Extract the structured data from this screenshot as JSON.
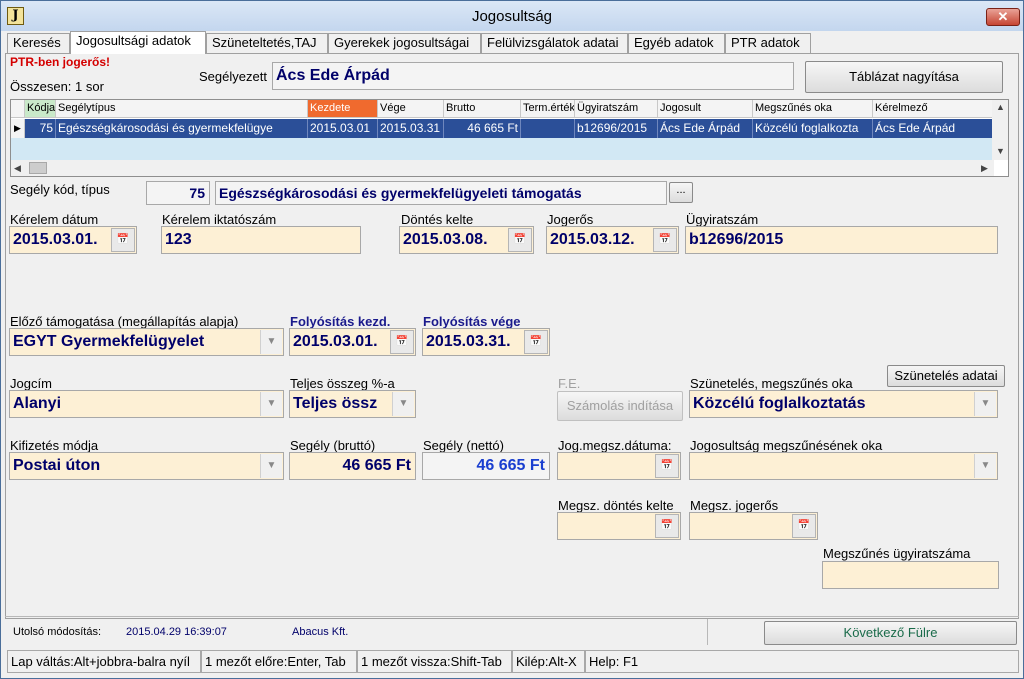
{
  "window": {
    "title": "Jogosultság",
    "app_icon_letter": "J",
    "close_glyph": "✕"
  },
  "tabs": [
    {
      "label": "Keresés"
    },
    {
      "label": "Jogosultsági adatok",
      "active": true
    },
    {
      "label": "Szüneteltetés,TAJ"
    },
    {
      "label": "Gyerekek jogosultságai"
    },
    {
      "label": "Felülvizsgálatok adatai"
    },
    {
      "label": "Egyéb adatok"
    },
    {
      "label": "PTR adatok"
    }
  ],
  "header": {
    "warning": "PTR-ben jogerős!",
    "count": "Összesen: 1 sor",
    "beneficiary_label": "Segélyezett",
    "beneficiary_value": "Ács Ede Árpád",
    "enlarge_button": "Táblázat nagyítása"
  },
  "grid": {
    "columns": [
      "Kódja",
      "Segélytípus",
      "Kezdete",
      "Vége",
      "Brutto",
      "Term.érték",
      "Ügyiratszám",
      "Jogosult",
      "Megszűnés oka",
      "Kérelmező"
    ],
    "rows": [
      [
        "75",
        "Egészségkárosodási és gyermekfelügye",
        "2015.03.01",
        "2015.03.31",
        "46 665 Ft",
        "",
        "b12696/2015",
        "Ács Ede Árpád",
        "Közcélú foglalkozta",
        "Ács Ede Árpád"
      ]
    ],
    "row_pointer": "▶"
  },
  "form": {
    "aid_code_label": "Segély kód, típus",
    "aid_code": "75",
    "aid_type": "Egészségkárosodási és gyermekfelügyeleti támogatás",
    "ellipsis": "...",
    "request_date_label": "Kérelem dátum",
    "request_date": "2015.03.01.",
    "request_reg_label": "Kérelem iktatószám",
    "request_reg": "123",
    "decision_date_label": "Döntés kelte",
    "decision_date": "2015.03.08.",
    "final_label": "Jogerős",
    "final_date": "2015.03.12.",
    "file_no_label": "Ügyiratszám",
    "file_no": "b12696/2015",
    "prev_support_label": "Előző támogatása (megállapítás alapja)",
    "prev_support": "EGYT Gyermekfelügyelet",
    "pay_start_label": "Folyósítás kezd.",
    "pay_start": "2015.03.01.",
    "pay_end_label": "Folyósítás vége",
    "pay_end": "2015.03.31.",
    "title_label": "Jogcím",
    "title_value": "Alanyi",
    "full_pct_label": "Teljes összeg %-a",
    "full_pct": "Teljes össz",
    "fe_label": "F.E.",
    "calc_button": "Számolás indítása",
    "suspend_reason_label": "Szünetelés, megszűnés oka",
    "suspend_button": "Szünetelés adatai",
    "suspend_reason": "Közcélú foglalkoztatás",
    "payment_method_label": "Kifizetés módja",
    "payment_method": "Postai úton",
    "gross_label": "Segély (bruttó)",
    "gross": "46 665 Ft",
    "net_label": "Segély (nettó)",
    "net": "46 665 Ft",
    "end_date_label": "Jog.megsz.dátuma:",
    "end_reason_label": "Jogosultság megszűnésének oka",
    "end_decision_label": "Megsz. döntés kelte",
    "end_final_label": "Megsz. jogerős",
    "end_file_label": "Megszűnés ügyiratszáma"
  },
  "footer": {
    "last_mod_label": "Utolsó módosítás:",
    "last_mod_time": "2015.04.29 16:39:07",
    "last_mod_user": "Abacus Kft.",
    "next_button": "Következő Fülre"
  },
  "statusbar": [
    "Lap váltás:Alt+jobbra-balra nyíl",
    "1 mezőt előre:Enter, Tab",
    "1 mezőt vissza:Shift-Tab",
    "Kilép:Alt-X",
    "Help: F1"
  ]
}
